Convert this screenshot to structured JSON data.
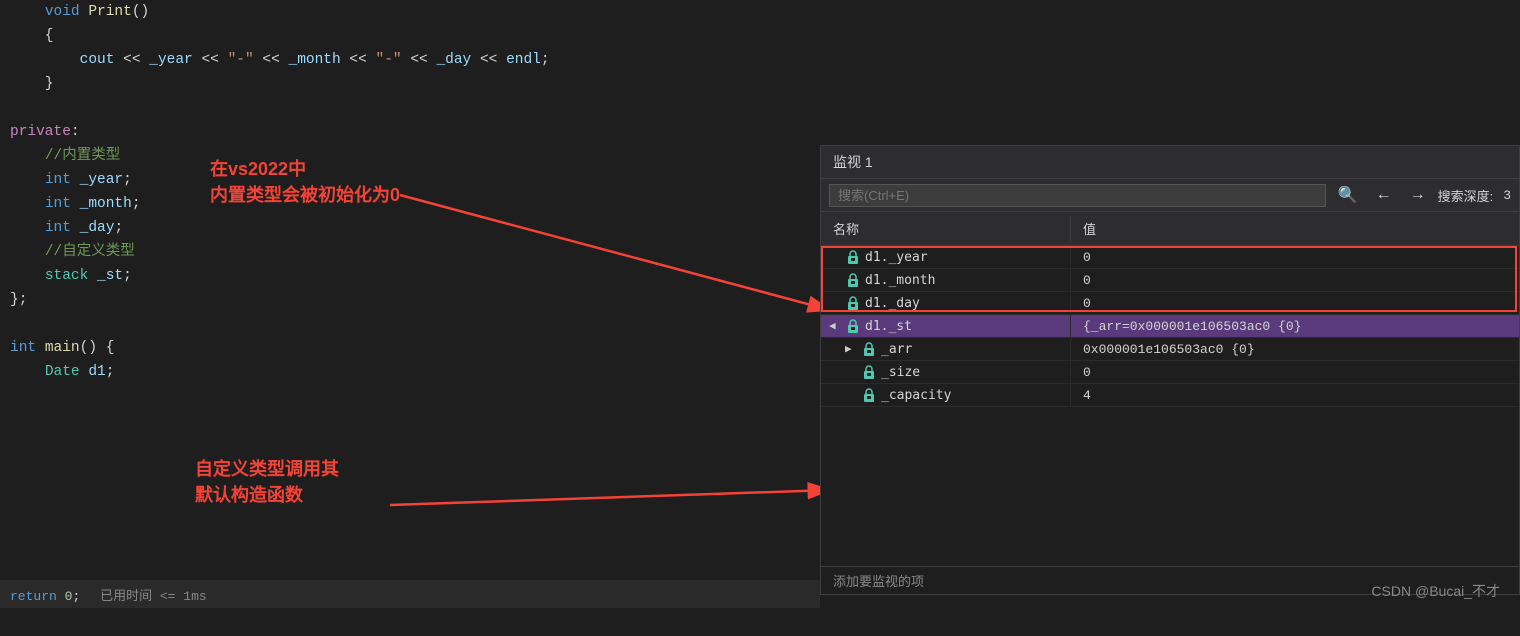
{
  "codeLines": [
    {
      "id": "line1",
      "content": "    void Print()",
      "class": ""
    },
    {
      "id": "line2",
      "content": "    {",
      "class": ""
    },
    {
      "id": "line3",
      "content": "        cout << _year << \"-\" << _month << \"-\" << _day << endl;",
      "class": ""
    },
    {
      "id": "line4",
      "content": "    }",
      "class": ""
    },
    {
      "id": "line5",
      "content": "",
      "class": ""
    },
    {
      "id": "line6",
      "content": "private:",
      "class": ""
    },
    {
      "id": "line7",
      "content": "    //内置类型",
      "class": ""
    },
    {
      "id": "line8",
      "content": "    int _year;",
      "class": ""
    },
    {
      "id": "line9",
      "content": "    int _month;",
      "class": ""
    },
    {
      "id": "line10",
      "content": "    int _day;",
      "class": ""
    },
    {
      "id": "line11",
      "content": "    //自定义类型",
      "class": ""
    },
    {
      "id": "line12",
      "content": "    stack _st;",
      "class": ""
    },
    {
      "id": "line13",
      "content": "};",
      "class": ""
    },
    {
      "id": "line14",
      "content": "",
      "class": ""
    },
    {
      "id": "line15",
      "content": "int main() {",
      "class": ""
    },
    {
      "id": "line16",
      "content": "    Date d1;",
      "class": ""
    }
  ],
  "annotations": {
    "ann1_line1": "在vs2022中",
    "ann1_line2": "内置类型会被初始化为0",
    "ann2_line1": "自定义类型调用其",
    "ann2_line2": "默认构造函数"
  },
  "watchPanel": {
    "title": "监视 1",
    "searchPlaceholder": "搜索(Ctrl+E)",
    "depthLabel": "搜索深度:",
    "depthValue": "3",
    "colName": "名称",
    "colValue": "值",
    "rows": [
      {
        "id": "r1",
        "name": "d1._year",
        "value": "0",
        "indent": 0,
        "hasExpand": false,
        "selected": false
      },
      {
        "id": "r2",
        "name": "d1._month",
        "value": "0",
        "indent": 0,
        "hasExpand": false,
        "selected": false
      },
      {
        "id": "r3",
        "name": "d1._day",
        "value": "0",
        "indent": 0,
        "hasExpand": false,
        "selected": false
      },
      {
        "id": "r4",
        "name": "d1._st",
        "value": "{_arr=0x000001e106503ac0 {0}",
        "indent": 0,
        "hasExpand": true,
        "selected": true
      },
      {
        "id": "r5",
        "name": "_arr",
        "value": "0x000001e106503ac0 {0}",
        "indent": 1,
        "hasExpand": true,
        "selected": false
      },
      {
        "id": "r6",
        "name": "_size",
        "value": "0",
        "indent": 1,
        "hasExpand": false,
        "selected": false
      },
      {
        "id": "r7",
        "name": "_capacity",
        "value": "4",
        "indent": 1,
        "hasExpand": false,
        "selected": false
      }
    ],
    "addRowLabel": "添加要监视的项"
  },
  "statusBar": {
    "returnText": "return 0;",
    "timeText": "已用时间 <= 1ms"
  },
  "watermark": "CSDN @Bucai_不才"
}
